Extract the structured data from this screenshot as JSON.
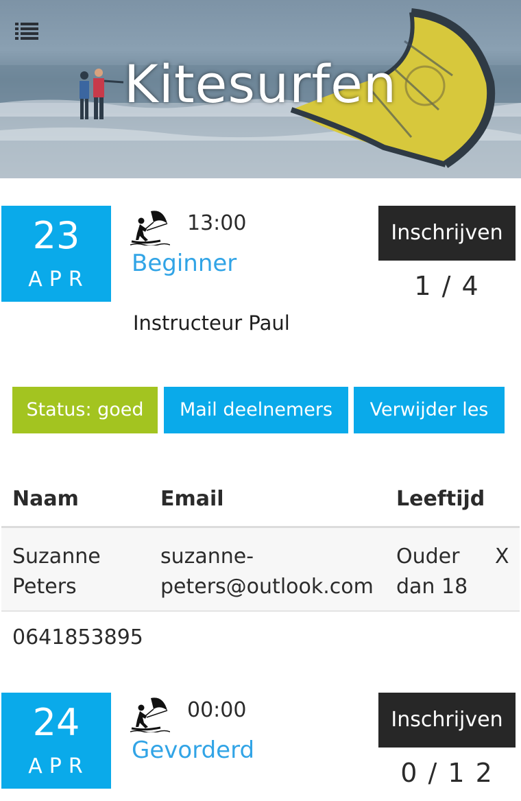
{
  "header": {
    "title": "Kitesurfen",
    "menu_icon": "list-icon"
  },
  "lessons": [
    {
      "day": "23",
      "month": "APR",
      "icon": "kitesurfer-icon",
      "time": "13:00",
      "level": "Beginner",
      "instructor": "Instructeur Paul",
      "signup_label": "Inschrijven",
      "count": "1 / 4",
      "actions": {
        "status": "Status: goed",
        "mail": "Mail deelnemers",
        "delete": "Verwijder les"
      },
      "table": {
        "headers": [
          "Naam",
          "Email",
          "Leeftijd"
        ],
        "rows": [
          {
            "name_line1": "Suzanne",
            "name_line2": "Peters",
            "email_line1": "suzanne-",
            "email_line2": "peters@outlook.com",
            "age_line1": "Ouder",
            "age_line2": "dan 18",
            "remove": "X",
            "phone": "0641853895"
          }
        ]
      }
    },
    {
      "day": "24",
      "month": "APR",
      "icon": "kitesurfer-icon",
      "time": "00:00",
      "level": "Gevorderd",
      "signup_label": "Inschrijven",
      "count": "0 / 1 2"
    }
  ],
  "colors": {
    "date_box": "#0aaaea",
    "level_text": "#31a4e6",
    "status_green": "#a3c420",
    "button_dark": "#272727"
  }
}
